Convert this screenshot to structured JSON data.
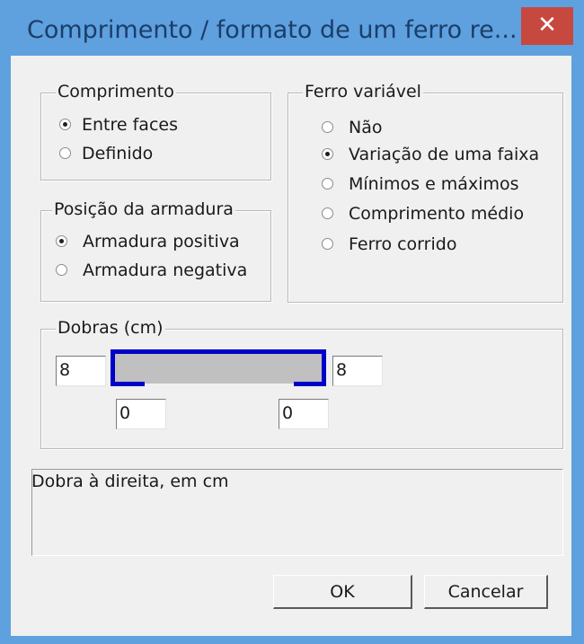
{
  "window": {
    "title": "Comprimento / formato de um ferro re...",
    "close_label": "✕"
  },
  "comprimento": {
    "legend": "Comprimento",
    "options": [
      "Entre faces",
      "Definido"
    ],
    "selected": "Entre faces"
  },
  "ferro_variavel": {
    "legend": "Ferro variável",
    "options": [
      "Não",
      "Variação de uma faixa",
      "Mínimos e máximos",
      "Comprimento médio",
      "Ferro corrido"
    ],
    "selected": "Variação de uma faixa"
  },
  "posicao": {
    "legend": "Posição da armadura",
    "options": [
      "Armadura positiva",
      "Armadura negativa"
    ],
    "selected": "Armadura positiva"
  },
  "dobras": {
    "legend": "Dobras (cm)",
    "left_top": "8",
    "right_top": "8",
    "left_bottom": "0",
    "right_bottom": "0"
  },
  "status": {
    "text": "Dobra à direita, em cm"
  },
  "buttons": {
    "ok": "OK",
    "cancel": "Cancelar"
  },
  "colors": {
    "title_bar": "#5fa0df",
    "close_button": "#c7483f",
    "bar_outline": "#0000c8",
    "bar_fill": "#c0c0c0"
  }
}
